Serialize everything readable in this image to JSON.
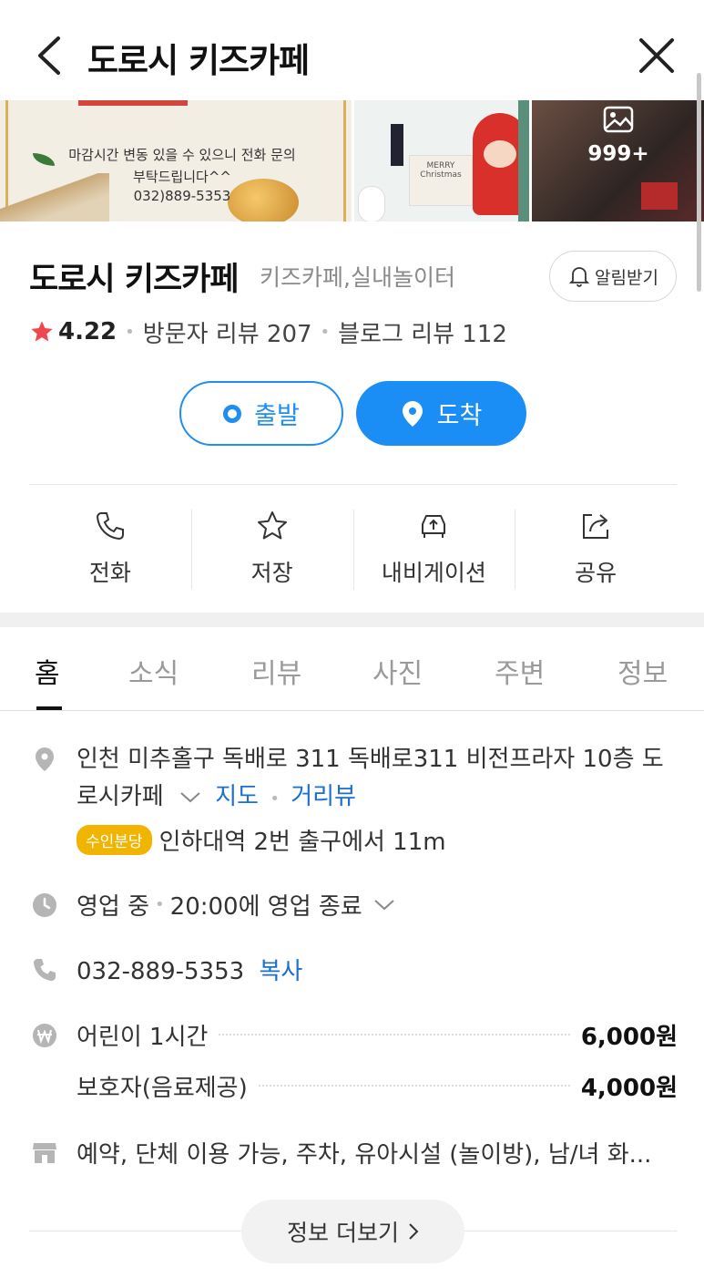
{
  "header": {
    "title": "도로시 키즈카페"
  },
  "photos": {
    "notice_text": "마감시간 변동 있을 수 있으니 전화 문의 부탁드립니다^^",
    "notice_phone": "032)889-5353",
    "ornament_text": "MERRY Christmas",
    "count": "999+"
  },
  "place": {
    "name": "도로시 키즈카페",
    "category": "키즈카페,실내놀이터",
    "notify_label": "알림받기",
    "rating": "4.22",
    "visitor_reviews": "방문자 리뷰 207",
    "blog_reviews": "블로그 리뷰 112"
  },
  "route": {
    "depart_label": "출발",
    "arrive_label": "도착"
  },
  "actions": [
    {
      "label": "전화",
      "icon": "phone-icon"
    },
    {
      "label": "저장",
      "icon": "star-icon"
    },
    {
      "label": "내비게이션",
      "icon": "car-icon"
    },
    {
      "label": "공유",
      "icon": "share-icon"
    }
  ],
  "tabs": [
    "홈",
    "소식",
    "리뷰",
    "사진",
    "주변",
    "정보"
  ],
  "info": {
    "address": "인천 미추홀구 독배로 311 독배로311 비전프라자 10층 도로시카페",
    "map_link": "지도",
    "street_link": "거리뷰",
    "subway_badge": "수인분당",
    "subway_text": "인하대역 2번 출구에서 11m",
    "status": "영업 중",
    "hours": "20:00에 영업 종료",
    "phone": "032-889-5353",
    "copy_label": "복사",
    "prices": [
      {
        "name": "어린이 1시간",
        "value": "6,000원"
      },
      {
        "name": "보호자(음료제공)",
        "value": "4,000원"
      }
    ],
    "amenities": "예약, 단체 이용 가능, 주차, 유아시설 (놀이방), 남/녀 화...",
    "more_label": "정보 더보기"
  },
  "colors": {
    "accent": "#1a8ef5",
    "link": "#1a6fd1",
    "star": "#f0474f",
    "badge": "#f1b400"
  }
}
